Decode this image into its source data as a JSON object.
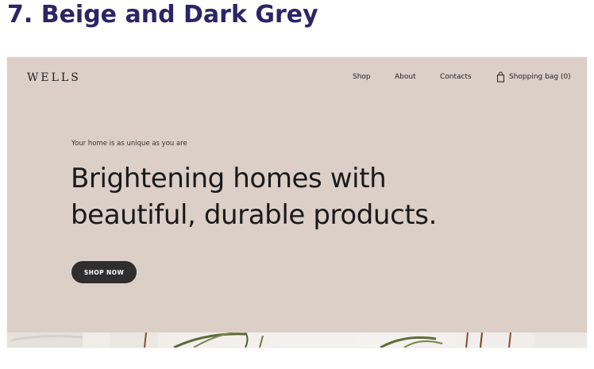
{
  "article": {
    "heading": "7. Beige and Dark Grey"
  },
  "site": {
    "brand": "WELLS",
    "nav": {
      "shop": "Shop",
      "about": "About",
      "contacts": "Contacts",
      "bag": "Shopping bag (0)",
      "bag_icon": "shopping-bag-icon"
    },
    "hero": {
      "tagline": "Your home is as unique as you are",
      "title_line1": "Brightening homes with",
      "title_line2": "beautiful, durable products.",
      "cta": "SHOP NOW"
    },
    "colors": {
      "background": "#dccfc7",
      "button": "#2f2d2d",
      "heading": "#2b2566"
    }
  }
}
